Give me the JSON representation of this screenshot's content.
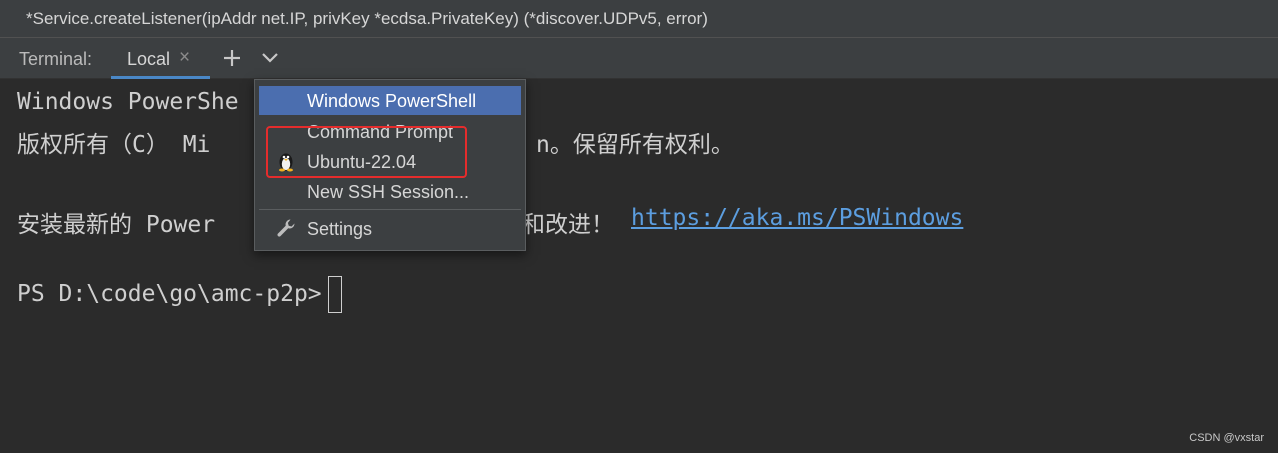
{
  "signature_bar": {
    "text": "*Service.createListener(ipAddr net.IP, privKey *ecdsa.PrivateKey) (*discover.UDPv5, error)"
  },
  "tabbar": {
    "terminal_label": "Terminal:",
    "tabs": [
      {
        "label": "Local",
        "close_glyph": "×",
        "active": true
      }
    ],
    "new_tab_icon": "plus-icon",
    "dropdown_icon": "chevron-down-icon"
  },
  "terminal": {
    "lines": [
      "Windows PowerShe",
      "版权所有（C） Mi",
      "",
      "安装最新的 Power",
      "",
      "PS D:\\code\\go\\amc-p2p>"
    ],
    "visible_fragments": {
      "line2_tail": "n。保留所有权利。",
      "line4_tail": "和改进！",
      "link": "https://aka.ms/PSWindows"
    }
  },
  "dropdown_menu": {
    "items": [
      {
        "label": "Windows PowerShell",
        "selected": true,
        "icon": ""
      },
      {
        "label": "Command Prompt",
        "selected": false,
        "icon": ""
      },
      {
        "label": "Ubuntu-22.04",
        "selected": false,
        "icon": "linux-penguin-icon"
      },
      {
        "label": "New SSH Session...",
        "selected": false,
        "icon": ""
      },
      {
        "label": "Settings",
        "selected": false,
        "icon": "wrench-icon"
      }
    ]
  },
  "annotation": {
    "color": "#e52c2c"
  },
  "watermark": {
    "text": "CSDN @vxstar"
  },
  "colors": {
    "background": "#2b2b2b",
    "panel": "#3c3f41",
    "selection": "#4b6eaf",
    "accent_underline": "#4a88c7",
    "link": "#5c9ee0"
  }
}
